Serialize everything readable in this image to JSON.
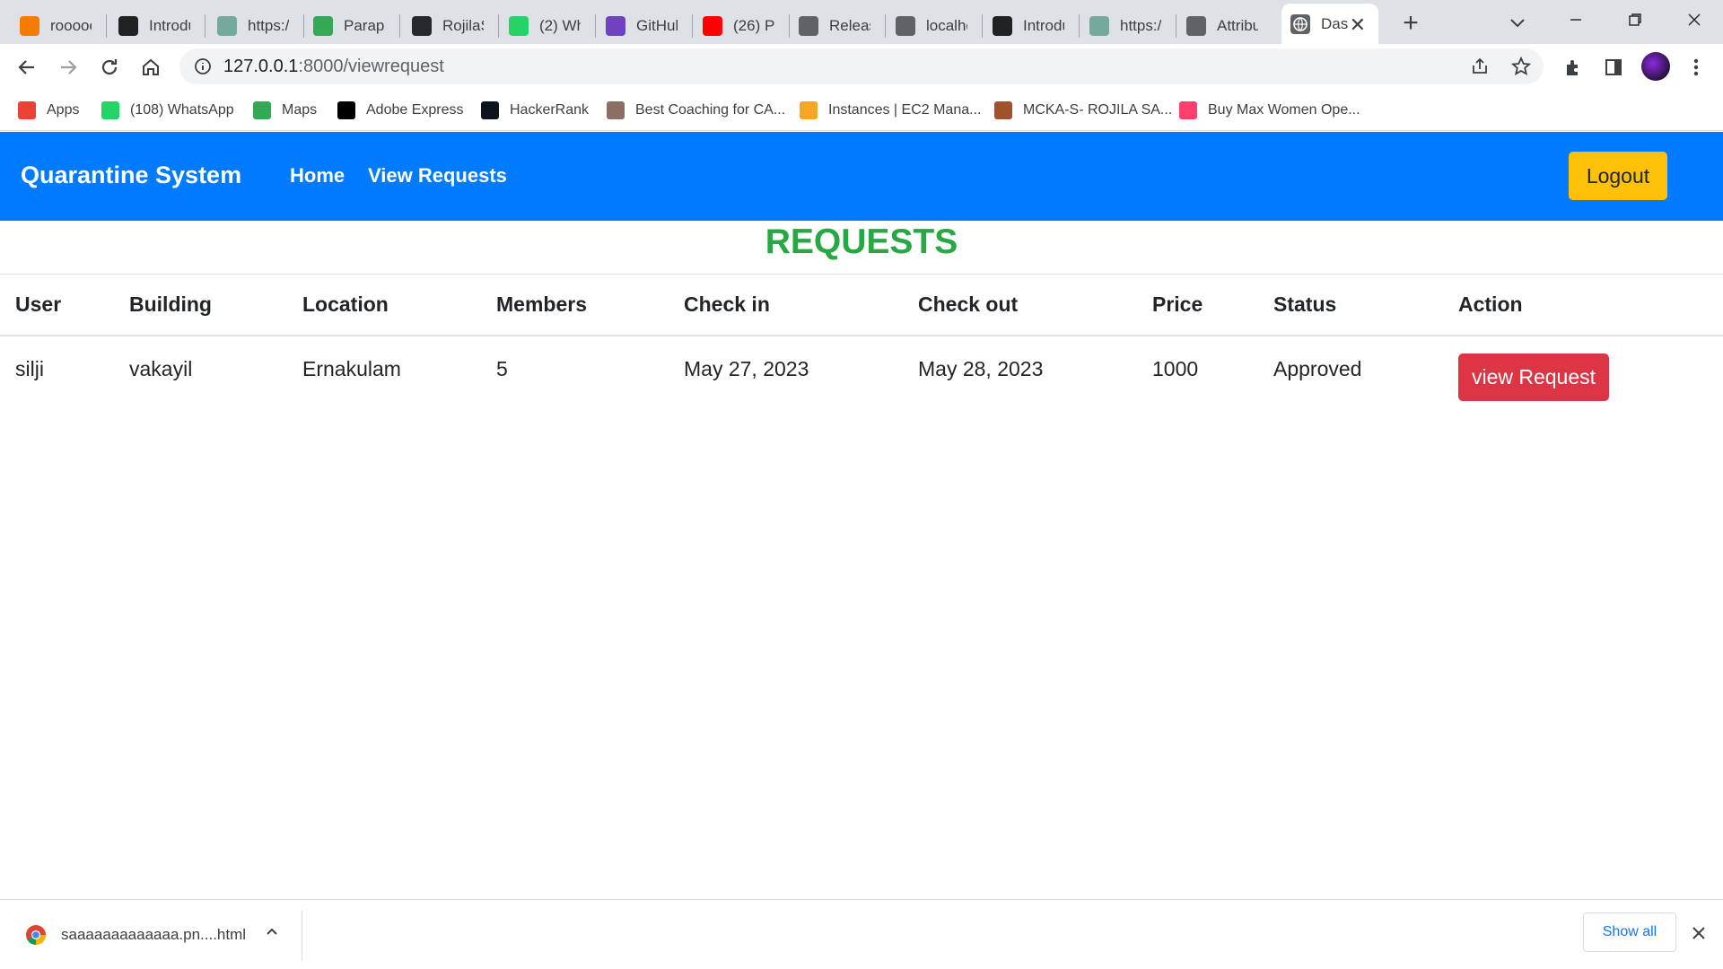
{
  "browser": {
    "tabs": [
      {
        "title": "rooooo",
        "icon": "orange-app-icon",
        "color": "#f57c00"
      },
      {
        "title": "Introdu",
        "icon": "openai-icon",
        "color": "#202123"
      },
      {
        "title": "https://",
        "icon": "chatgpt-icon",
        "color": "#74aa9c"
      },
      {
        "title": "Paraph",
        "icon": "robot-icon",
        "color": "#34a853"
      },
      {
        "title": "RojilaS/",
        "icon": "github-icon",
        "color": "#24292e"
      },
      {
        "title": "(2) Wha",
        "icon": "whatsapp-badge-icon",
        "color": "#25d366"
      },
      {
        "title": "GitHub",
        "icon": "list-icon",
        "color": "#6f42c1"
      },
      {
        "title": "(26) Pa",
        "icon": "youtube-icon",
        "color": "#ff0000"
      },
      {
        "title": "Release",
        "icon": "globe-icon",
        "color": "#5f6368"
      },
      {
        "title": "localho",
        "icon": "globe-icon",
        "color": "#5f6368"
      },
      {
        "title": "Introdu",
        "icon": "openai-icon",
        "color": "#202123"
      },
      {
        "title": "https://",
        "icon": "chatgpt-icon",
        "color": "#74aa9c"
      },
      {
        "title": "Attribut",
        "icon": "globe-icon",
        "color": "#5f6368"
      }
    ],
    "active_tab": {
      "title": "Das",
      "icon": "globe-icon"
    },
    "url_host": "127.0.0.1",
    "url_rest": ":8000/viewrequest",
    "bookmarks": [
      {
        "label": "Apps",
        "icon": "apps-grid-icon",
        "color": "#ea4335"
      },
      {
        "label": "(108) WhatsApp",
        "icon": "whatsapp-badge-icon",
        "color": "#25d366"
      },
      {
        "label": "Maps",
        "icon": "maps-icon",
        "color": "#34a853"
      },
      {
        "label": "Adobe Express",
        "icon": "adobe-express-icon",
        "color": "#000000"
      },
      {
        "label": "HackerRank",
        "icon": "hackerrank-icon",
        "color": "#0e141e"
      },
      {
        "label": "Best Coaching for CA...",
        "icon": "person-icon",
        "color": "#8d6e63"
      },
      {
        "label": "Instances | EC2 Mana...",
        "icon": "aws-box-icon",
        "color": "#f5a623"
      },
      {
        "label": "MCKA-S- ROJILA SA...",
        "icon": "cake-icon",
        "color": "#a0522d"
      },
      {
        "label": "Buy Max Women Ope...",
        "icon": "myntra-icon",
        "color": "#ff3f6c"
      }
    ]
  },
  "nav": {
    "brand": "Quarantine System",
    "links": [
      "Home",
      "View Requests"
    ],
    "logout": "Logout",
    "bg_color": "#007bff"
  },
  "page": {
    "title": "REQUESTS",
    "title_color": "#28a745",
    "columns": [
      "User",
      "Building",
      "Location",
      "Members",
      "Check in",
      "Check out",
      "Price",
      "Status",
      "Action"
    ],
    "rows": [
      {
        "user": "silji",
        "building": "vakayil",
        "location": "Ernakulam",
        "members": "5",
        "check_in": "May 27, 2023",
        "check_out": "May 28, 2023",
        "price": "1000",
        "status": "Approved",
        "action": "view Request"
      }
    ]
  },
  "downloads": {
    "file": "saaaaaaaaaaaaa.pn....html",
    "show_all": "Show all"
  }
}
